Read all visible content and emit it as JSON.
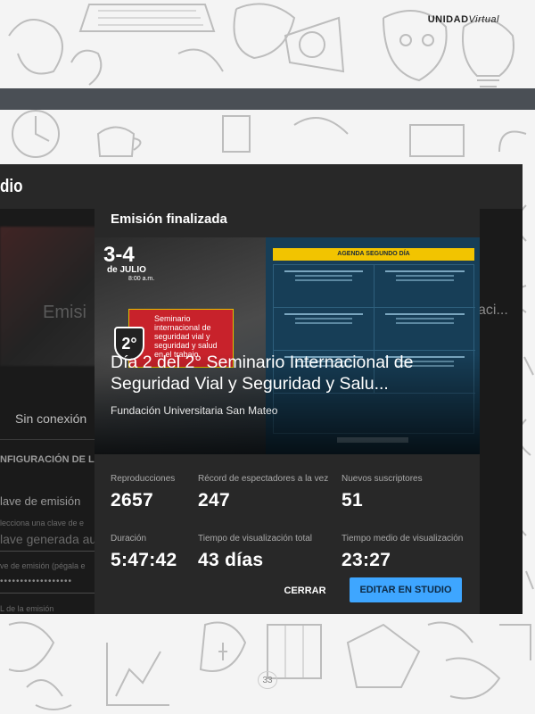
{
  "brand": {
    "bold": "UNIDAD",
    "light": "Virtual"
  },
  "page_number": "33",
  "studio": {
    "app_title": "dio",
    "bg_emision_fragment": "Emisi",
    "bg_title_fragment": "aci...",
    "bg_sin_conexion": "Sin conexión",
    "bg_config_label": "NFIGURACIÓN DE LA",
    "bg_clave_label": "lave de emisión",
    "bg_select_hint": "lecciona una clave de e",
    "bg_generated": "lave generada auto",
    "bg_paste_hint": "ve de emisión (pégala e",
    "bg_masked_key": "••••••••••••••••••",
    "bg_url_hint": "L de la emisión"
  },
  "dialog": {
    "title": "Emisión finalizada",
    "banner": {
      "date": "3-4",
      "month": "de JULIO",
      "time": "8:00 a.m.",
      "badge": "2°",
      "seminar_text": "Seminario internacional de seguridad vial y seguridad y salud en el trabajo",
      "agenda_heading": "AGENDA SEGUNDO DÍA"
    },
    "video_title": "Día 2 del 2° Seminario Internacional de Seguridad Vial y Seguridad y Salu...",
    "channel": "Fundación Universitaria San Mateo",
    "stats": [
      {
        "label": "Reproducciones",
        "value": "2657"
      },
      {
        "label": "Récord de espectadores a la vez",
        "value": "247"
      },
      {
        "label": "Nuevos suscriptores",
        "value": "51"
      },
      {
        "label": "Duración",
        "value": "5:47:42"
      },
      {
        "label": "Tiempo de visualización total",
        "value": "43 días"
      },
      {
        "label": "Tiempo medio de visualización",
        "value": "23:27"
      }
    ],
    "close_label": "CERRAR",
    "edit_label": "EDITAR EN STUDIO"
  },
  "colors": {
    "dialog_bg": "#282828",
    "primary_button": "#3ea6ff",
    "agenda_yellow": "#f2c400",
    "seminar_red": "#c8222b"
  }
}
